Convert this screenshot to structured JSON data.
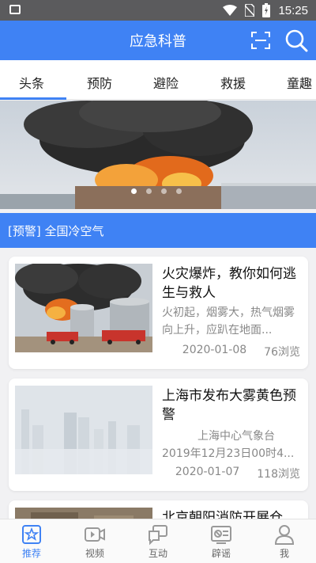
{
  "status_bar": {
    "time": "15:25",
    "icons": [
      "image-icon",
      "wifi-icon",
      "no-sim-icon",
      "battery-charging-icon"
    ]
  },
  "app_bar": {
    "title": "应急科普",
    "icons": [
      "scan-icon",
      "search-icon"
    ]
  },
  "tabs": [
    {
      "label": "头条",
      "active": true
    },
    {
      "label": "预防"
    },
    {
      "label": "避险"
    },
    {
      "label": "救援"
    },
    {
      "label": "童趣"
    }
  ],
  "banner": {
    "slides": 4,
    "active_index": 0
  },
  "alert": {
    "text": "[预警] 全国冷空气"
  },
  "articles": [
    {
      "title": "火灾爆炸，教你如何逃生与救人",
      "summary": "火初起，烟雾大，热气烟雾向上升，应趴在地面...",
      "date": "2020-01-08",
      "views": "76浏览"
    },
    {
      "title": "上海市发布大雾黄色预警",
      "source": "上海中心气象台",
      "summary": "2019年12月23日00时4...",
      "date": "2020-01-07",
      "views": "118浏览"
    },
    {
      "title": "北京朝阳消防开展仓"
    }
  ],
  "bottom_nav": [
    {
      "label": "推荐",
      "icon": "star-icon",
      "active": true
    },
    {
      "label": "视频",
      "icon": "video-icon"
    },
    {
      "label": "互动",
      "icon": "chat-icon"
    },
    {
      "label": "辟谣",
      "icon": "rumor-icon"
    },
    {
      "label": "我",
      "icon": "person-icon"
    }
  ],
  "colors": {
    "accent": "#3f82f4",
    "status_bar": "#5b5b5d",
    "background": "#f1f1f3"
  }
}
